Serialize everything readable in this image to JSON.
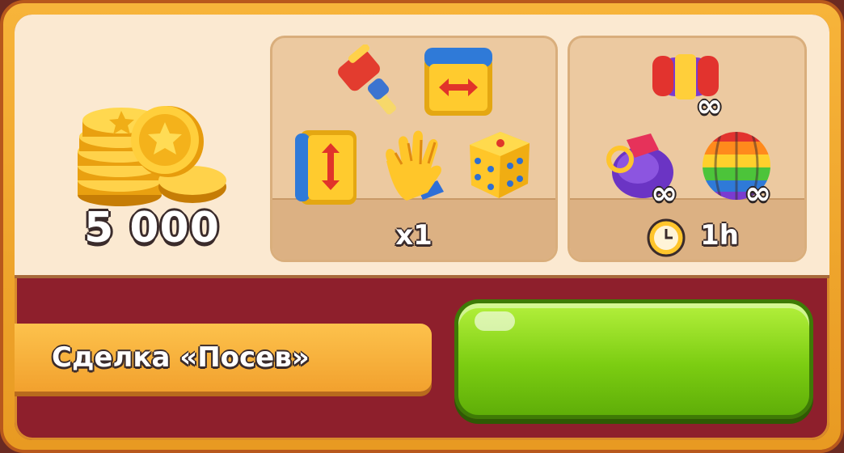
{
  "offer": {
    "coins_amount": "5 000",
    "boosters_label": "x1",
    "unlimited_label": "1h",
    "infinity_symbol": "∞",
    "title": "Сделка «Посев»"
  },
  "icons": {
    "coins": "gold-coins-stack-icon",
    "hammer": "hammer-icon",
    "horizontal_swap": "horizontal-arrows-block-icon",
    "vertical_swap": "vertical-arrows-block-icon",
    "glove": "glove-icon",
    "dice": "dice-icon",
    "rocket": "rocket-booster-icon",
    "bomb": "bomb-booster-icon",
    "disco_ball": "rainbow-ball-icon",
    "clock": "clock-icon"
  },
  "colors": {
    "frame": "#f7b43a",
    "panel": "#fbe9d1",
    "bottom": "#8e1f2c",
    "button": "#7ccd12",
    "ribbon": "#f2a12e"
  }
}
